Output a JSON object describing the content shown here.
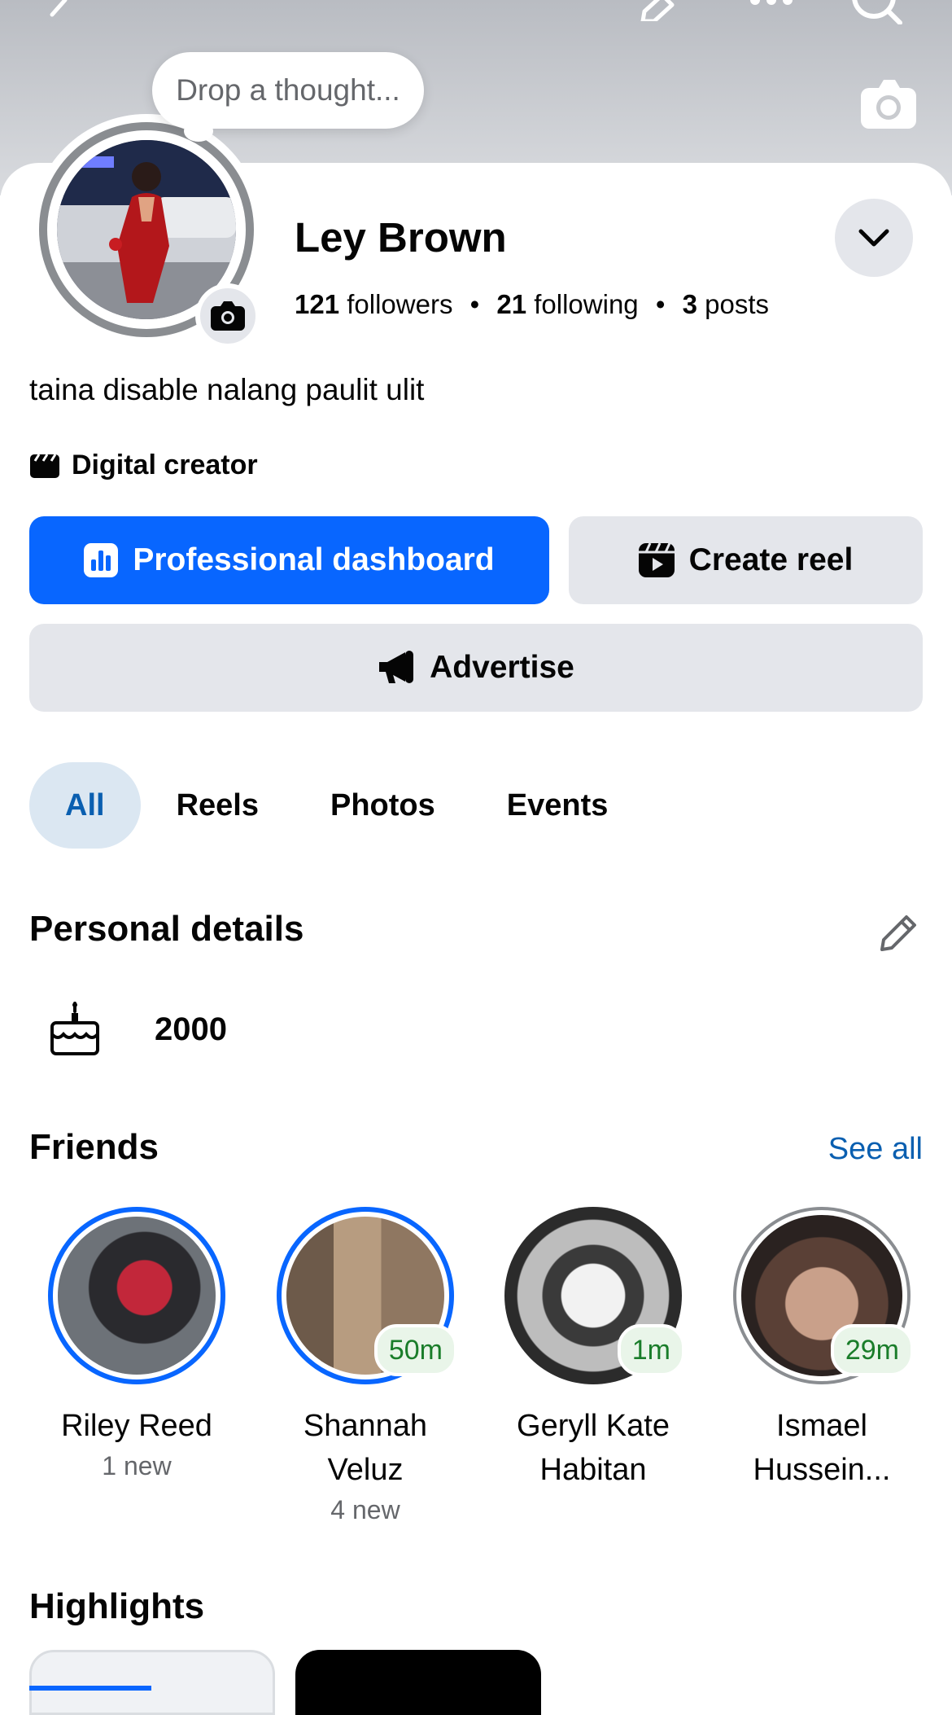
{
  "profile": {
    "thought_placeholder": "Drop a thought...",
    "name": "Ley Brown",
    "followers_count": "121",
    "followers_label": "followers",
    "following_count": "21",
    "following_label": "following",
    "posts_count": "3",
    "posts_label": "posts",
    "bio": "taina disable nalang paulit ulit",
    "category": "Digital creator"
  },
  "actions": {
    "dashboard": "Professional dashboard",
    "create_reel": "Create reel",
    "advertise": "Advertise"
  },
  "tabs": [
    {
      "label": "All",
      "active": true
    },
    {
      "label": "Reels",
      "active": false
    },
    {
      "label": "Photos",
      "active": false
    },
    {
      "label": "Events",
      "active": false
    }
  ],
  "personal_details": {
    "title": "Personal details",
    "birth_year": "2000"
  },
  "friends": {
    "title": "Friends",
    "see_all": "See all",
    "items": [
      {
        "name_line1": "Riley Reed",
        "name_line2": "",
        "new_label": "1 new",
        "time": ""
      },
      {
        "name_line1": "Shannah",
        "name_line2": "Veluz",
        "new_label": "4 new",
        "time": "50m"
      },
      {
        "name_line1": "Geryll Kate",
        "name_line2": "Habitan",
        "new_label": "",
        "time": "1m"
      },
      {
        "name_line1": "Ismael",
        "name_line2": "Hussein...",
        "new_label": "",
        "time": "29m"
      }
    ]
  },
  "highlights": {
    "title": "Highlights"
  },
  "colors": {
    "accent": "#0866ff",
    "link": "#0a5fb0",
    "button_gray": "#e4e6eb",
    "online_green": "#1a7d2a"
  },
  "icons": [
    "back-arrow-icon",
    "edit-icon",
    "more-icon",
    "search-icon",
    "camera-icon",
    "chevron-down-icon",
    "clapperboard-icon",
    "dashboard-icon",
    "reel-icon",
    "megaphone-icon",
    "pencil-icon",
    "cake-icon"
  ]
}
